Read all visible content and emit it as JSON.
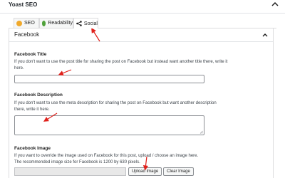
{
  "panel": {
    "title": "Yoast SEO"
  },
  "tabs": [
    {
      "label": "SEO",
      "icon": "seo-status-dot-icon",
      "color": "#f0a92c"
    },
    {
      "label": "Readability",
      "icon": "readability-status-dot-icon",
      "color": "#4fa13a"
    },
    {
      "label": "Social",
      "icon": "share-icon",
      "active": true
    }
  ],
  "facebook": {
    "heading": "Facebook",
    "title_field": {
      "label": "Facebook Title",
      "help": "If you don't want to use the post title for sharing the post on Facebook but instead want another title there, write it here.",
      "value": ""
    },
    "description_field": {
      "label": "Facebook Description",
      "help": "If you don't want to use the meta description for sharing the post on Facebook but want another description there, write it here.",
      "value": ""
    },
    "image_field": {
      "label": "Facebook Image",
      "help_line1": "If you want to override the image used on Facebook for this post, upload / choose an image here.",
      "help_line2": "The recommended image size for Facebook is 1200 by 630 pixels.",
      "value": "",
      "upload_label": "Upload Image",
      "clear_label": "Clear Image"
    }
  },
  "colors": {
    "annotation_arrow": "#e0201b",
    "border": "#dcdcde"
  }
}
